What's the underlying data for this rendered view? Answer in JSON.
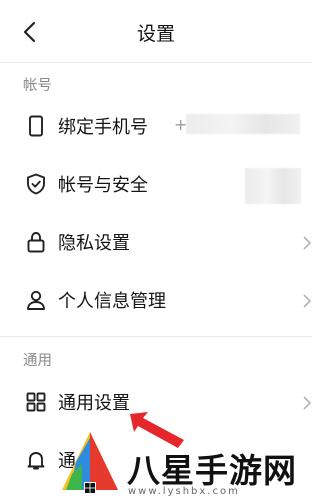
{
  "header": {
    "title": "设置"
  },
  "sections": {
    "account": {
      "label": "帐号"
    },
    "general": {
      "label": "通用"
    }
  },
  "rows": {
    "bind_phone": {
      "label": "绑定手机号",
      "value_prefix": "+"
    },
    "account_security": {
      "label": "帐号与安全"
    },
    "privacy": {
      "label": "隐私设置"
    },
    "personal_info": {
      "label": "个人信息管理"
    },
    "general_settings": {
      "label": "通用设置"
    },
    "notifications": {
      "label": "通"
    }
  },
  "watermark": {
    "name": "八星手游网",
    "url": "www.lyshbx.com"
  },
  "colors": {
    "text": "#151515",
    "section": "#8a8a8a",
    "annotation_arrow": "#e5262a"
  },
  "icons": {
    "back": "chevron-left-icon",
    "bind_phone": "phone-icon",
    "account_security": "shield-check-icon",
    "privacy": "lock-icon",
    "personal_info": "person-icon",
    "general_settings": "grid-icon",
    "notifications": "bell-icon"
  }
}
